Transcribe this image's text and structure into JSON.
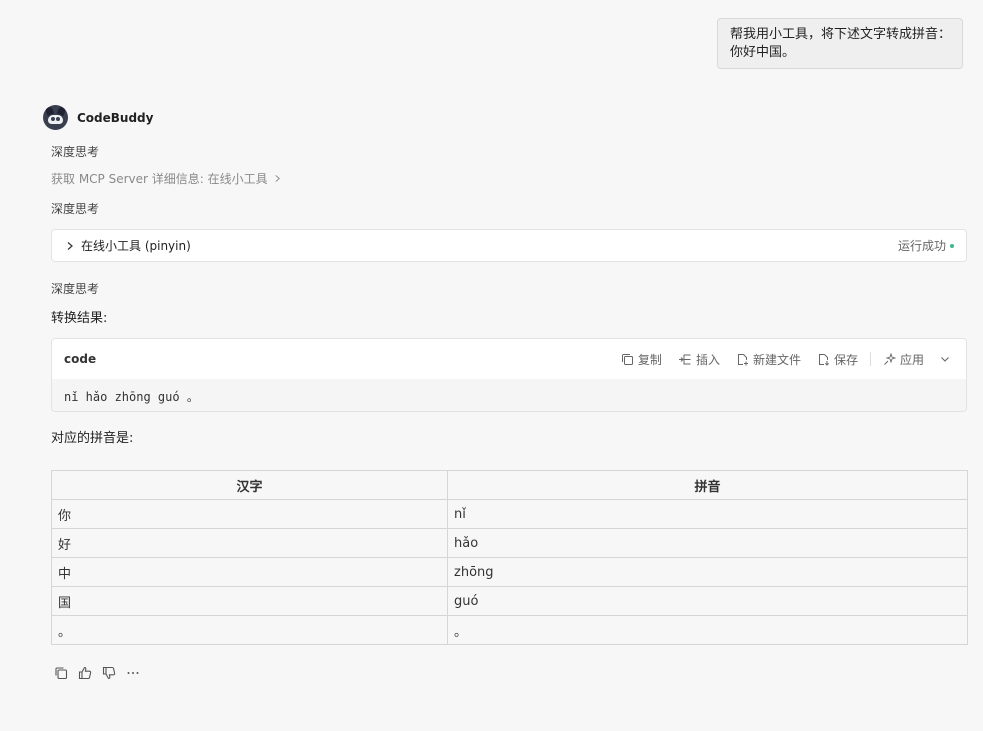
{
  "user_message": {
    "line1": "帮我用小工具，将下述文字转成拼音：",
    "line2": "你好中国。"
  },
  "agent": {
    "name": "CodeBuddy"
  },
  "steps": {
    "think1": "深度思考",
    "mcp_link": "获取 MCP Server 详细信息: 在线小工具",
    "think2": "深度思考",
    "think3": "深度思考"
  },
  "tool_call": {
    "name": "在线小工具 (pinyin)",
    "status": "运行成功",
    "status_color": "#3fb68b"
  },
  "result_label": "转换结果:",
  "code_block": {
    "language": "code",
    "actions": {
      "copy": "复制",
      "insert": "插入",
      "new_file": "新建文件",
      "save": "保存",
      "apply": "应用"
    },
    "content": "nǐ hǎo zhōng guó 。"
  },
  "pinyin_label": "对应的拼音是:",
  "table": {
    "headers": [
      "汉字",
      "拼音"
    ],
    "rows": [
      [
        "你",
        "nǐ"
      ],
      [
        "好",
        "hǎo"
      ],
      [
        "中",
        "zhōng"
      ],
      [
        "国",
        "guó"
      ],
      [
        "。",
        "。"
      ]
    ]
  },
  "feedback_icons": [
    "copy-icon",
    "thumbs-up-icon",
    "thumbs-down-icon",
    "more-icon"
  ]
}
